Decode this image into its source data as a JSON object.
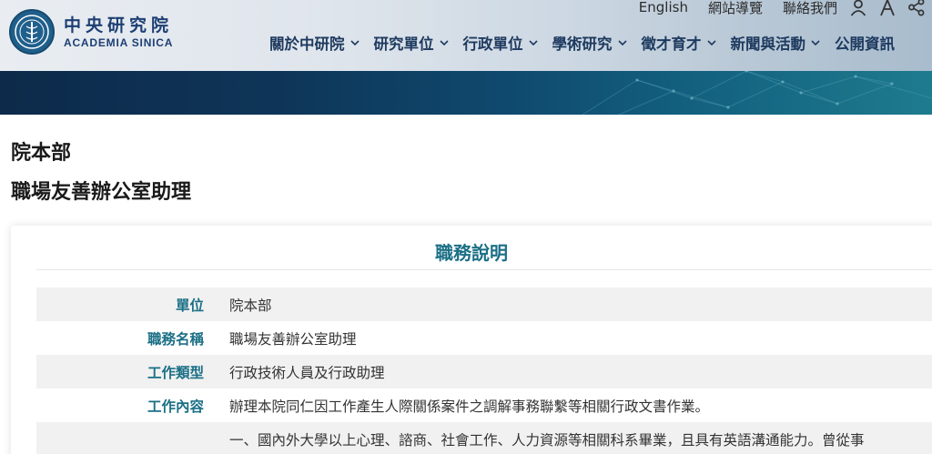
{
  "logo": {
    "zh": "中央研究院",
    "en": "ACADEMIA SINICA"
  },
  "util_links": [
    "English",
    "網站導覽",
    "聯絡我們"
  ],
  "util_icons": [
    "user-icon",
    "font-size-icon",
    "share-icon"
  ],
  "nav": [
    "關於中研院",
    "研究單位",
    "行政單位",
    "學術研究",
    "徵才育才",
    "新聞與活動",
    "公開資訊"
  ],
  "page": {
    "dept": "院本部",
    "job": "職場友善辦公室助理"
  },
  "card": {
    "heading": "職務說明",
    "rows": [
      {
        "label": "單位",
        "value": "院本部"
      },
      {
        "label": "職務名稱",
        "value": "職場友善辦公室助理"
      },
      {
        "label": "工作類型",
        "value": "行政技術人員及行政助理"
      },
      {
        "label": "工作內容",
        "value": "辦理本院同仁因工作產生人際關係案件之調解事務聯繫等相關行政文書作業。"
      },
      {
        "label": "",
        "value": "一、國內外大學以上心理、諮商、社會工作、人力資源等相關科系畢業，且具有英語溝通能力。曾從事"
      }
    ]
  },
  "colors": {
    "accent": "#1b6f86",
    "nav": "#1e3a5f",
    "logo": "#1d3f73"
  }
}
